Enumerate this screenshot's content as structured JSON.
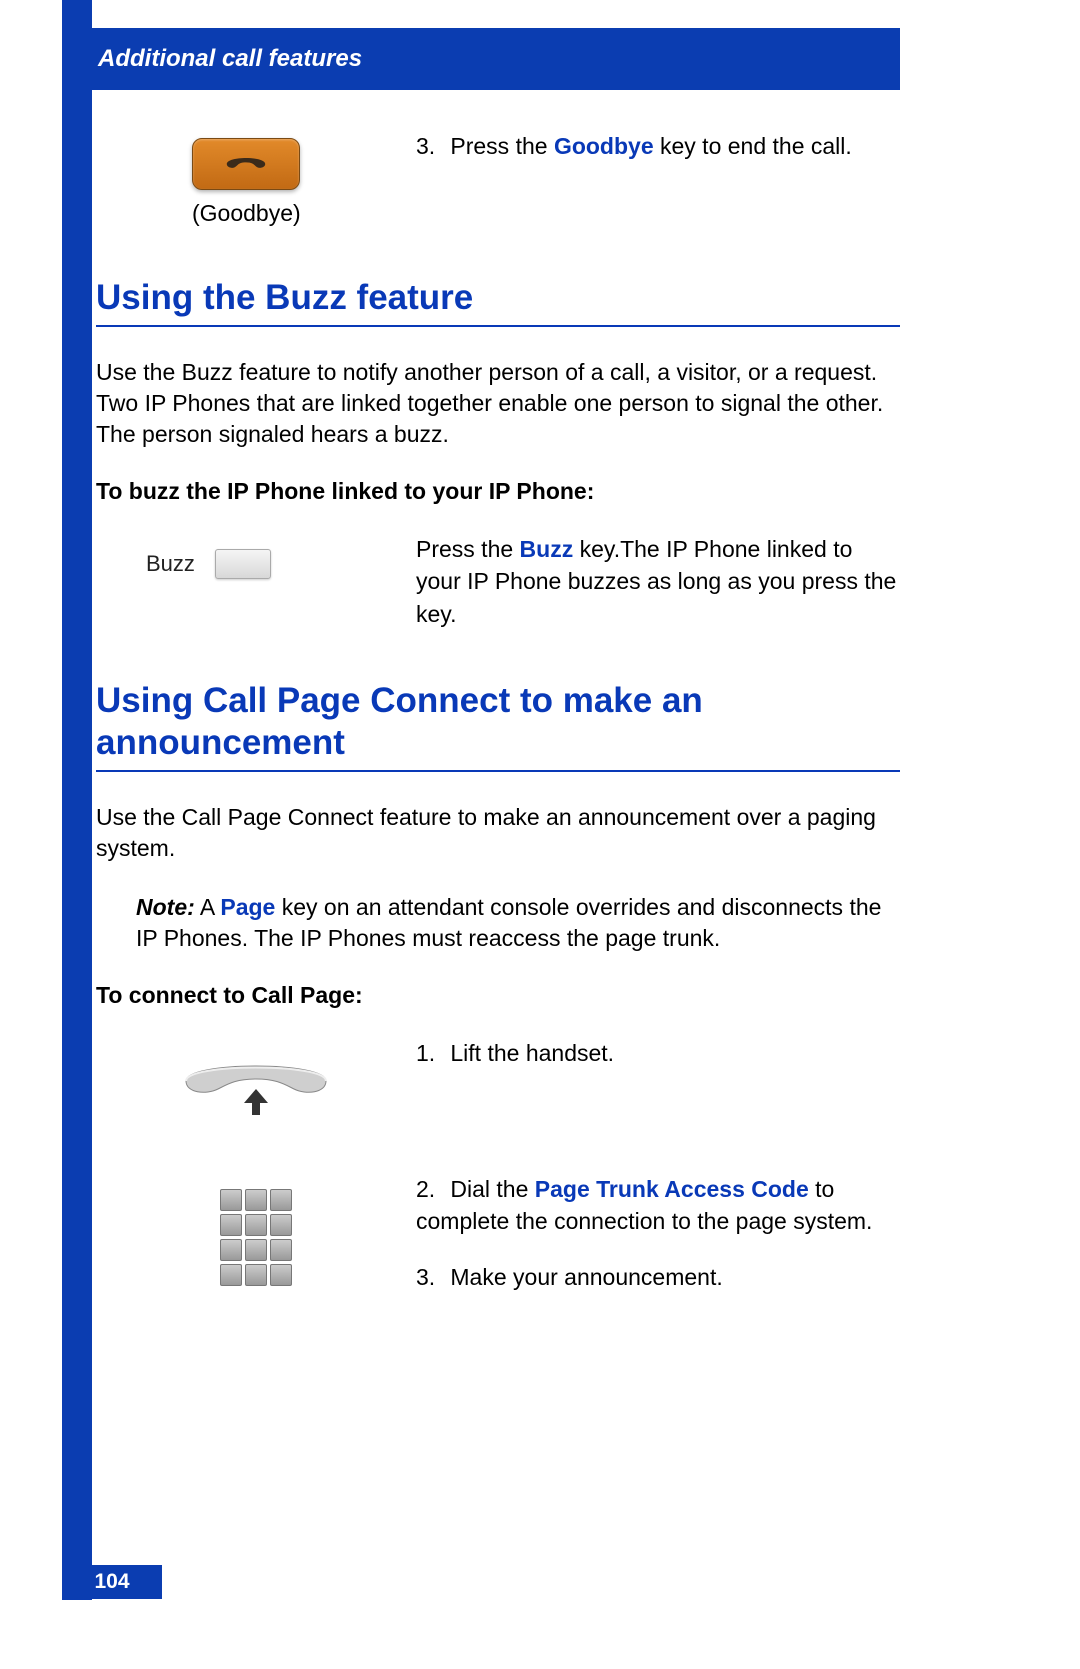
{
  "header": {
    "title": "Additional call features"
  },
  "goodbye": {
    "icon_label": "(Goodbye)",
    "step_num": "3.",
    "text_pre": "Press the ",
    "kw": "Goodbye",
    "text_post": " key to end the call."
  },
  "buzz": {
    "heading": "Using the Buzz feature",
    "body": "Use the Buzz feature to notify another person of a call, a visitor, or a request. Two IP Phones that are linked together enable one person to signal the other. The person signaled hears a buzz.",
    "sub": "To buzz the IP Phone linked to your IP Phone:",
    "icon_label": "Buzz",
    "step_pre": "Press the ",
    "step_kw": "Buzz",
    "step_post": " key.The IP Phone linked to your IP Phone buzzes as long as you press the key."
  },
  "callpage": {
    "heading": "Using Call Page Connect to make an announcement",
    "body": "Use the Call Page Connect feature to make an announcement over a paging system.",
    "note_label": "Note:",
    "note_pre": " A ",
    "note_kw": "Page",
    "note_post": " key on an attendant console overrides and disconnects the IP Phones. The IP Phones must reaccess the page trunk.",
    "sub": "To connect to Call Page:",
    "step1_num": "1.",
    "step1_text": "Lift the handset.",
    "step2_num": "2.",
    "step2_pre": "Dial the ",
    "step2_kw": "Page Trunk Access Code",
    "step2_post": " to complete the connection to the page system.",
    "step3_num": "3.",
    "step3_text": "Make your announcement."
  },
  "footer": {
    "page": "104"
  }
}
